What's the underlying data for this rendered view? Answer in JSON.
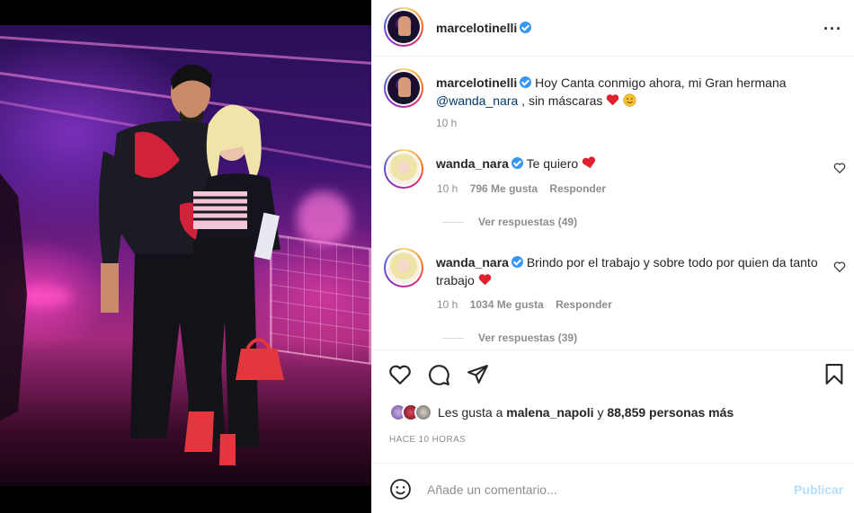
{
  "post": {
    "author": "marcelotinelli",
    "caption_author": "marcelotinelli",
    "caption_text_1": "Hoy Canta conmigo ahora, mi Gran hermana",
    "caption_mention": "@wanda_nara",
    "caption_text_2": " , sin máscaras",
    "caption_time": "10 h",
    "more_icon": "more-horizontal-icon"
  },
  "comments": [
    {
      "user": "wanda_nara",
      "text": "Te quiero",
      "emoji": "❤",
      "time": "10 h",
      "likes": "796 Me gusta",
      "reply": "Responder",
      "view_replies": "Ver respuestas (49)"
    },
    {
      "user": "wanda_nara",
      "text": "Brindo por el trabajo y sobre todo por quien da tanto trabajo",
      "emoji": "❤",
      "time": "10 h",
      "likes": "1034 Me gusta",
      "reply": "Responder",
      "view_replies": "Ver respuestas (39)"
    }
  ],
  "likes": {
    "prefix": "Les gusta a",
    "user": "malena_napoli",
    "middle": "y",
    "count": "88,859 personas más"
  },
  "timestamp": "HACE 10 HORAS",
  "comment_box": {
    "placeholder": "Añade un comentario...",
    "publish": "Publicar"
  },
  "colors": {
    "verified": "#3897f0",
    "heart": "#ed4956",
    "mention": "#00376b",
    "publish_disabled": "#b2dffc"
  }
}
